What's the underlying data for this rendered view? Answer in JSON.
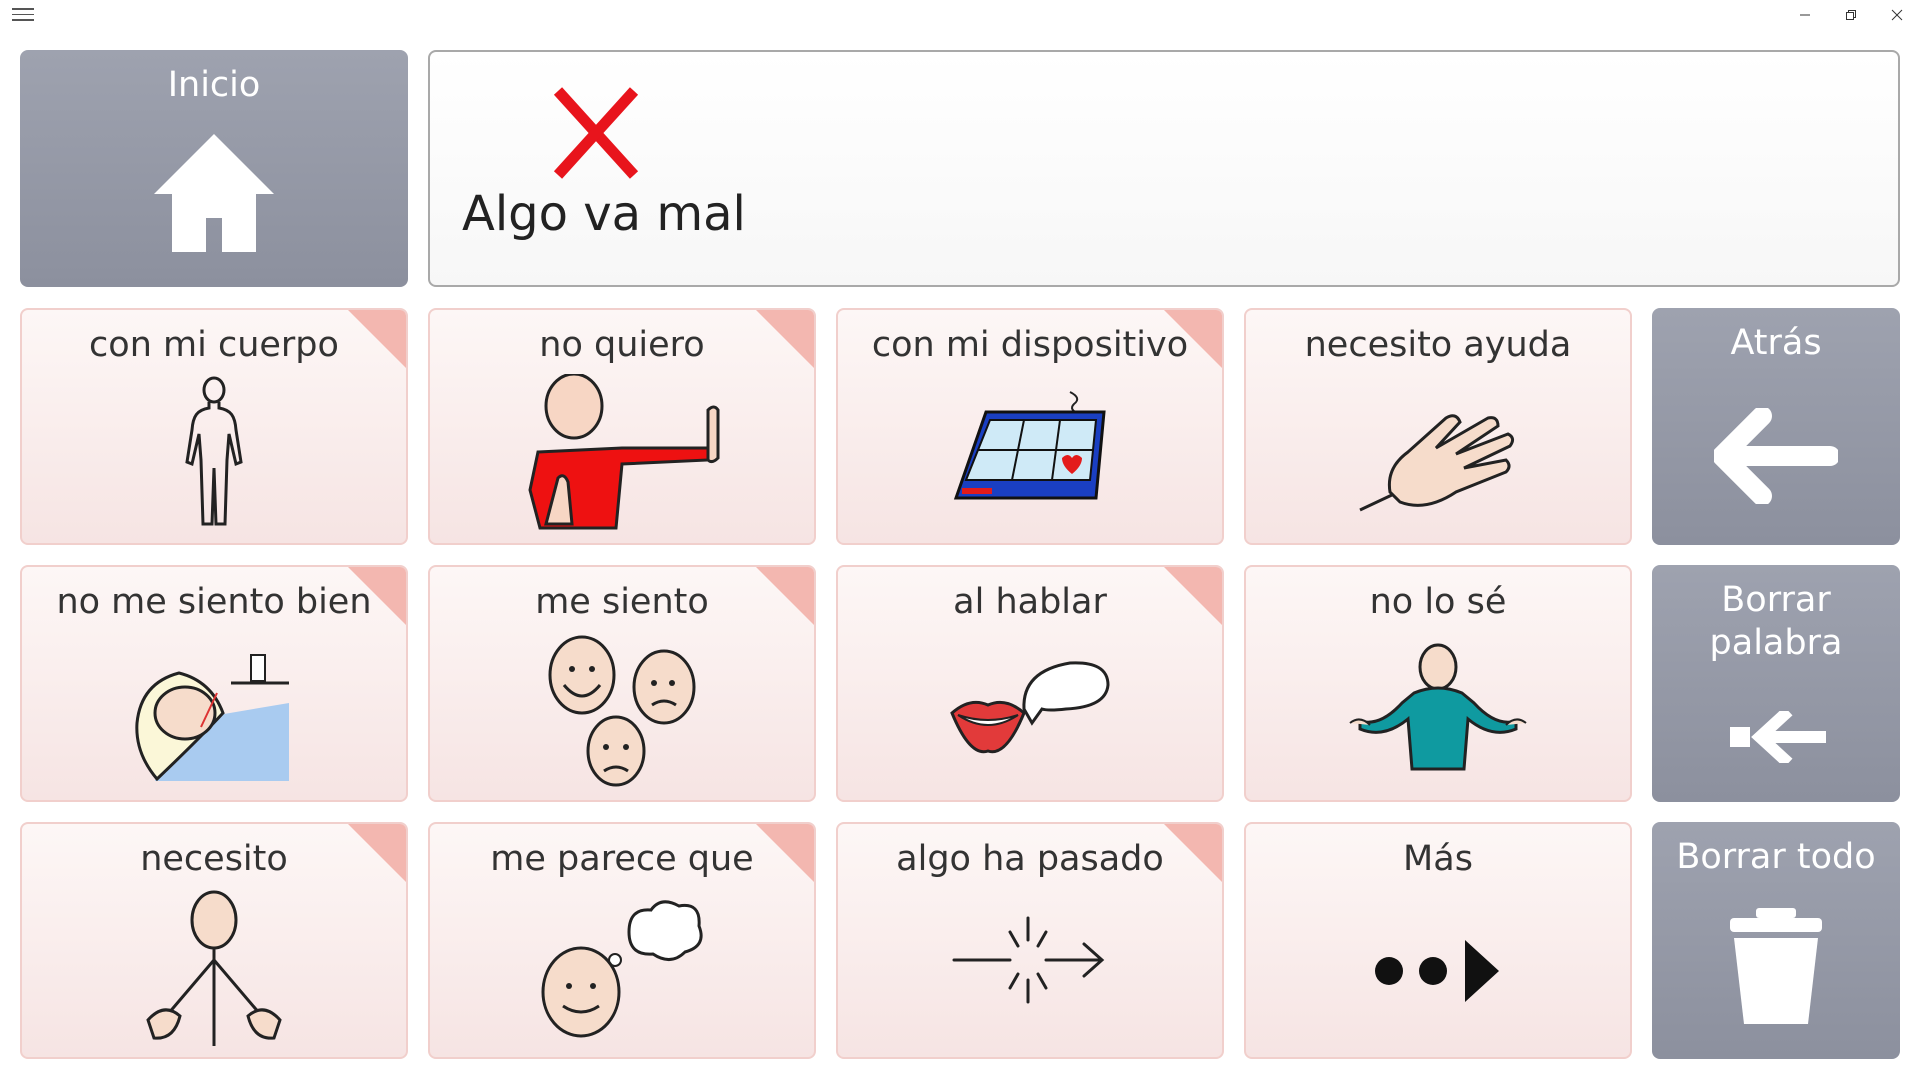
{
  "window": {
    "menu_icon": "hamburger-menu-icon",
    "controls": [
      "minimize-icon",
      "restore-icon",
      "close-icon"
    ]
  },
  "home": {
    "label": "Inicio",
    "icon": "house-icon"
  },
  "message_bar": {
    "symbol": "red-x-icon",
    "text": "Algo va mal",
    "symbol_color": "#e8141c"
  },
  "grid": {
    "row1": [
      "con mi cuerpo",
      "no quiero",
      "con mi dispositivo",
      "necesito ayuda"
    ],
    "row2": [
      "no me siento bien",
      "me siento",
      "al hablar",
      "no lo sé"
    ],
    "row3": [
      "necesito",
      "me parece que",
      "algo ha pasado",
      "Más"
    ]
  },
  "actions": {
    "back": {
      "label": "Atrás",
      "icon": "arrow-left-icon"
    },
    "delete_word": {
      "label_line1": "Borrar",
      "label_line2": "palabra",
      "icon": "backspace-arrow-icon"
    },
    "delete_all": {
      "label": "Borrar todo",
      "icon": "trash-can-icon"
    }
  },
  "colors": {
    "gray_tile": "#9599a7",
    "pink_tile": "#f9ebea",
    "corner_tab": "#f3b7b0",
    "red_shirt": "#ee1111"
  }
}
